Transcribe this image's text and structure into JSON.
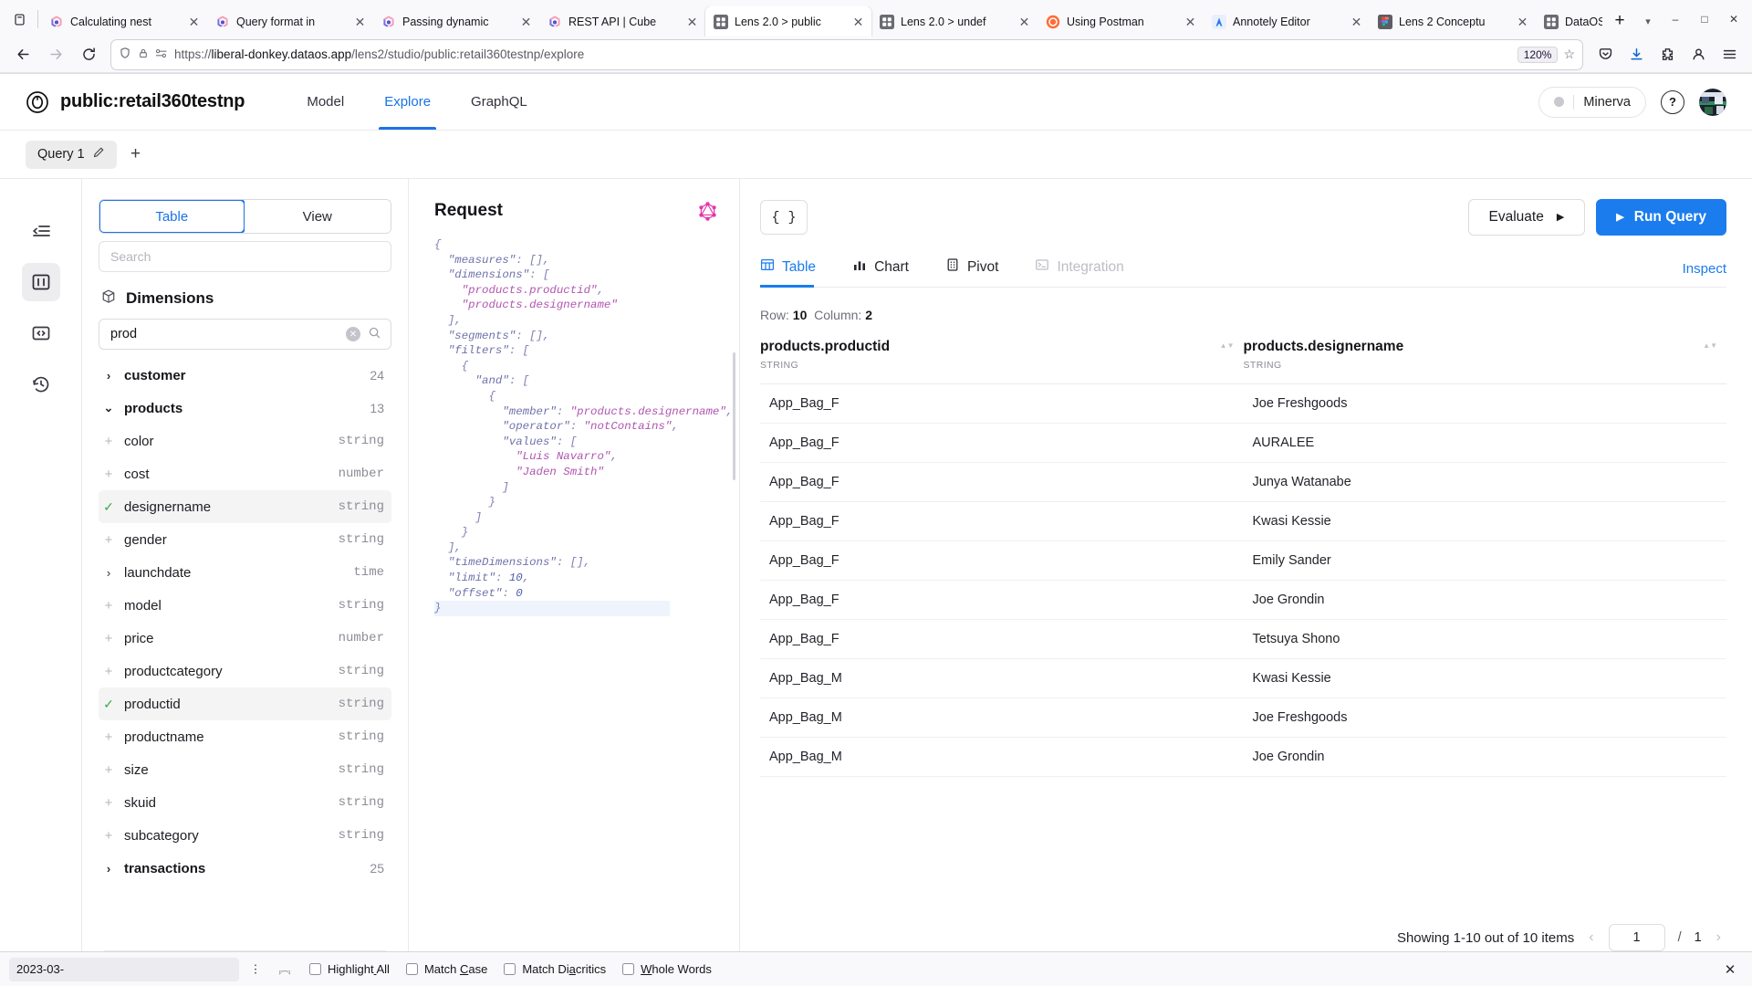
{
  "browser": {
    "tabs": [
      {
        "title": "Calculating nest",
        "favicon": "cube-icon",
        "active": false
      },
      {
        "title": "Query format in",
        "favicon": "cube-icon",
        "active": false
      },
      {
        "title": "Passing dynamic",
        "favicon": "cube-icon",
        "active": false
      },
      {
        "title": "REST API | Cube",
        "favicon": "cube-icon",
        "active": false
      },
      {
        "title": "Lens 2.0 > public",
        "favicon": "grid-icon",
        "active": true
      },
      {
        "title": "Lens 2.0 > undef",
        "favicon": "grid-icon",
        "active": false
      },
      {
        "title": "Using Postman",
        "favicon": "postman-icon",
        "active": false
      },
      {
        "title": "Annotely Editor",
        "favicon": "annotely-icon",
        "active": false
      },
      {
        "title": "Lens 2 Conceptu",
        "favicon": "figma-icon",
        "active": false
      },
      {
        "title": "DataOS | App",
        "favicon": "grid-icon",
        "active": false
      }
    ],
    "new_tab_label": "+",
    "url_prefix": "https://",
    "url_host": "liberal-donkey.dataos.app",
    "url_path": "/lens2/studio/public:retail360testnp/explore",
    "zoom": "120%",
    "window_controls": [
      "minimize",
      "maximize",
      "close"
    ]
  },
  "app": {
    "brand": "public:retail360testnp",
    "nav": [
      {
        "label": "Model",
        "active": false
      },
      {
        "label": "Explore",
        "active": true
      },
      {
        "label": "GraphQL",
        "active": false
      }
    ],
    "user": "Minerva",
    "help": "?"
  },
  "query_tabs": {
    "tabs": [
      {
        "label": "Query 1"
      }
    ],
    "add_label": "+"
  },
  "rail": [
    {
      "icon": "collapse-panel-icon",
      "active": false
    },
    {
      "icon": "columns-icon",
      "active": true
    },
    {
      "icon": "code-icon",
      "active": false
    },
    {
      "icon": "history-icon",
      "active": false
    }
  ],
  "dimensions_panel": {
    "segments": [
      {
        "label": "Table",
        "active": true
      },
      {
        "label": "View",
        "active": false
      }
    ],
    "top_search_placeholder": "Search",
    "title": "Dimensions",
    "search_value": "prod",
    "search_placeholder": "Search",
    "groups": [
      {
        "name": "customer",
        "count": "24",
        "expanded": false,
        "fields": []
      },
      {
        "name": "products",
        "count": "13",
        "expanded": true,
        "fields": [
          {
            "name": "color",
            "type": "string",
            "state": "add"
          },
          {
            "name": "cost",
            "type": "number",
            "state": "add"
          },
          {
            "name": "designername",
            "type": "string",
            "state": "selected"
          },
          {
            "name": "gender",
            "type": "string",
            "state": "add"
          },
          {
            "name": "launchdate",
            "type": "time",
            "state": "expand"
          },
          {
            "name": "model",
            "type": "string",
            "state": "add"
          },
          {
            "name": "price",
            "type": "number",
            "state": "add"
          },
          {
            "name": "productcategory",
            "type": "string",
            "state": "add"
          },
          {
            "name": "productid",
            "type": "string",
            "state": "selected"
          },
          {
            "name": "productname",
            "type": "string",
            "state": "add"
          },
          {
            "name": "size",
            "type": "string",
            "state": "add"
          },
          {
            "name": "skuid",
            "type": "string",
            "state": "add"
          },
          {
            "name": "subcategory",
            "type": "string",
            "state": "add"
          }
        ]
      },
      {
        "name": "transactions",
        "count": "25",
        "expanded": false,
        "fields": []
      }
    ]
  },
  "request_panel": {
    "title": "Request",
    "icon": "graphql-icon",
    "code": "{\n  \"measures\": [],\n  \"dimensions\": [\n    \"products.productid\",\n    \"products.designername\"\n  ],\n  \"segments\": [],\n  \"filters\": [\n    {\n      \"and\": [\n        {\n          \"member\": \"products.designername\",\n          \"operator\": \"notContains\",\n          \"values\": [\n            \"Luis Navarro\",\n            \"Jaden Smith\"\n          ]\n        }\n      ]\n    }\n  ],\n  \"timeDimensions\": [],\n  \"limit\": 10,\n  \"offset\": 0\n}"
  },
  "results": {
    "json_button": "{ }",
    "evaluate_label": "Evaluate",
    "run_query_label": "Run Query",
    "tabs": [
      {
        "label": "Table",
        "icon": "table-icon",
        "active": true,
        "disabled": false
      },
      {
        "label": "Chart",
        "icon": "bar-chart-icon",
        "active": false,
        "disabled": false
      },
      {
        "label": "Pivot",
        "icon": "pivot-icon",
        "active": false,
        "disabled": false
      },
      {
        "label": "Integration",
        "icon": "terminal-icon",
        "active": false,
        "disabled": true
      }
    ],
    "inspect_label": "Inspect",
    "row_label": "Row:",
    "row_count": "10",
    "column_label": "Column:",
    "column_count": "2",
    "columns": [
      {
        "name": "products.productid",
        "type": "STRING"
      },
      {
        "name": "products.designername",
        "type": "STRING"
      }
    ],
    "rows": [
      [
        "App_Bag_F",
        "Joe Freshgoods"
      ],
      [
        "App_Bag_F",
        "AURALEE"
      ],
      [
        "App_Bag_F",
        "Junya Watanabe"
      ],
      [
        "App_Bag_F",
        "Kwasi Kessie"
      ],
      [
        "App_Bag_F",
        "Emily Sander"
      ],
      [
        "App_Bag_F",
        "Joe Grondin"
      ],
      [
        "App_Bag_F",
        "Tetsuya Shono"
      ],
      [
        "App_Bag_M",
        "Kwasi Kessie"
      ],
      [
        "App_Bag_M",
        "Joe Freshgoods"
      ],
      [
        "App_Bag_M",
        "Joe Grondin"
      ]
    ],
    "pagination": {
      "showing": "Showing 1-10 out of 10 items",
      "current_page": "1",
      "separator": "/",
      "total_pages": "1"
    }
  },
  "findbar": {
    "value": "2023-03-",
    "options": [
      {
        "label": "Highlight All",
        "checked": false
      },
      {
        "label": "Match Case",
        "checked": false
      },
      {
        "label": "Match Diacritics",
        "checked": false
      },
      {
        "label": "Whole Words",
        "checked": false
      }
    ]
  },
  "colors": {
    "accent": "#1b7ced",
    "brand_blue": "#1a73e8",
    "selected_green": "#3ea84b",
    "string_purple": "#b055b0"
  }
}
